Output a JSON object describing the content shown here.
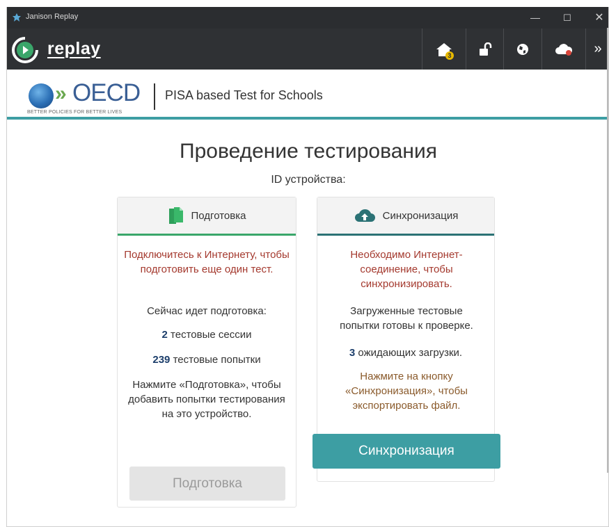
{
  "window": {
    "title": "Janison Replay",
    "min_glyph": "—",
    "max_glyph": "☐",
    "close_glyph": "✕"
  },
  "toolbar": {
    "logo_text": "replay",
    "home_badge": "3",
    "more_glyph": "»",
    "icons": [
      "home-icon",
      "unlock-icon",
      "globe-icon",
      "cloud-offline-icon",
      "chevron-double-right-icon"
    ]
  },
  "header": {
    "oecd_word": "OECD",
    "oecd_tagline": "BETTER POLICIES FOR BETTER LIVES",
    "product": "PISA based Test for Schools"
  },
  "main": {
    "title": "Проведение тестирования",
    "device_id_label": "ID устройства:"
  },
  "prep_card": {
    "title": "Подготовка",
    "warning": "Подключитесь к Интернету, чтобы подготовить еще один тест.",
    "status_label": "Сейчас идет подготовка:",
    "sessions_count": "2",
    "sessions_label": "тестовые сессии",
    "attempts_count": "239",
    "attempts_label": "тестовые попытки",
    "hint": "Нажмите «Подготовка», чтобы добавить попытки тестирования на это устройство.",
    "button_label": "Подготовка"
  },
  "sync_card": {
    "title": "Синхронизация",
    "warning": "Необходимо Интернет-соединение, чтобы синхронизировать.",
    "status": "Загруженные тестовые попытки готовы к проверке.",
    "pending_count": "3",
    "pending_label": "ожидающих загрузки.",
    "hint": "Нажмите на кнопку «Синхронизация», чтобы экспортировать файл.",
    "button_label": "Синхронизация"
  },
  "colors": {
    "accent_teal": "#3d9ea3",
    "prep_green": "#3aa66a",
    "warning_red": "#a4392e",
    "hint_brown": "#8a5a2b",
    "badge_yellow": "#e6b800"
  }
}
